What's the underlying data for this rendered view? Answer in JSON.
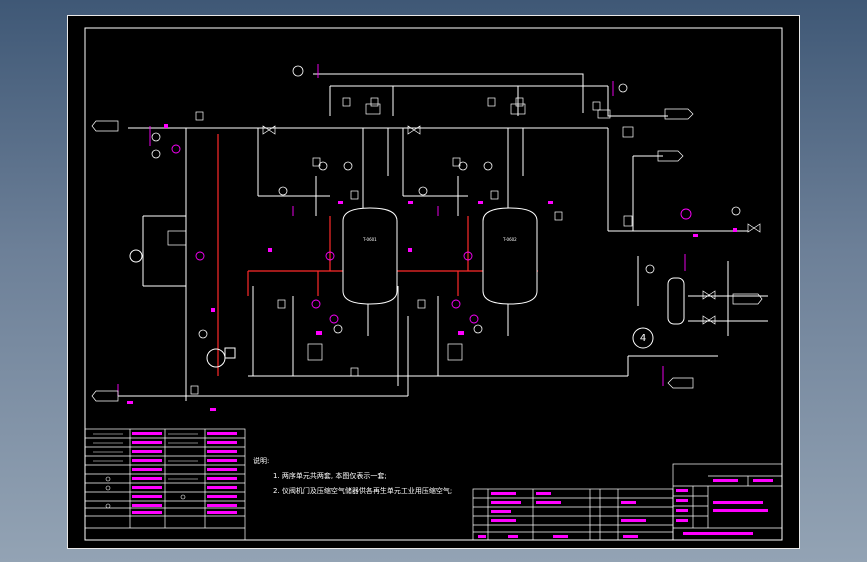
{
  "notes": {
    "heading": "说明:",
    "item1": "1. 两序单元共两套, 本图仅表示一套;",
    "item2": "2. 仪阀机门及压缩空气储器供各再生单元工业用压缩空气;"
  },
  "balloon": "4",
  "colors": {
    "paper": "#000000",
    "pipe": "#ffffff",
    "red_pipe": "#ff2a2a",
    "magenta_tag": "#ff00ff",
    "frame": "#e8e8e8"
  }
}
